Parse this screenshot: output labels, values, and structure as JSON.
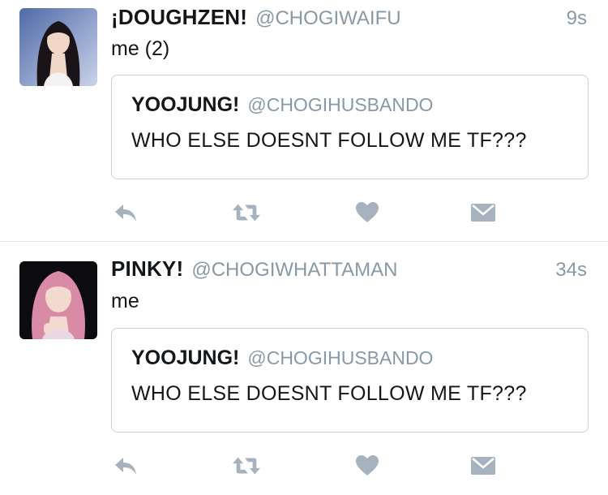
{
  "colors": {
    "text": "#14171a",
    "secondary": "#8899a6",
    "icon": "#a6b3be",
    "border": "#c8d1d8"
  },
  "tweets": [
    {
      "author": {
        "name": "¡DOUGHZEN!",
        "handle": "@CHOGIWAIFU"
      },
      "time": "9s",
      "text": "me (2)",
      "quote": {
        "name": "YOOJUNG!",
        "handle": "@CHOGIHUSBANDO",
        "text": "WHO ELSE DOESNT FOLLOW ME TF???"
      },
      "actions": [
        "reply-icon",
        "retweet-icon",
        "heart-icon",
        "direct-message-icon"
      ]
    },
    {
      "author": {
        "name": "PINKY!",
        "handle": "@CHOGIWHATTAMAN"
      },
      "time": "34s",
      "text": "me",
      "quote": {
        "name": "YOOJUNG!",
        "handle": "@CHOGIHUSBANDO",
        "text": "WHO ELSE DOESNT FOLLOW ME TF???"
      },
      "actions": [
        "reply-icon",
        "retweet-icon",
        "heart-icon",
        "direct-message-icon"
      ]
    }
  ]
}
